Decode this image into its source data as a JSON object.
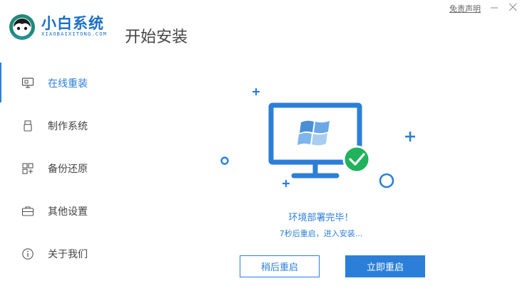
{
  "brand": {
    "name": "小白系统",
    "sub": "XIAOBAIXITONG.COM",
    "color": "#1a6fc7"
  },
  "header": {
    "title": "开始安装",
    "disclaimer": "免责声明"
  },
  "sidebar": {
    "items": [
      {
        "label": "在线重装",
        "icon": "monitor-icon",
        "active": true
      },
      {
        "label": "制作系统",
        "icon": "usb-icon",
        "active": false
      },
      {
        "label": "备份还原",
        "icon": "backup-icon",
        "active": false
      },
      {
        "label": "其他设置",
        "icon": "briefcase-icon",
        "active": false
      },
      {
        "label": "关于我们",
        "icon": "info-icon",
        "active": false
      }
    ]
  },
  "main": {
    "status_title": "环境部署完毕！",
    "status_sub": "7秒后重启，进入安装...",
    "buttons": {
      "later": "稍后重启",
      "now": "立即重启"
    }
  },
  "colors": {
    "accent": "#2b7fd9",
    "success": "#21b25b"
  }
}
